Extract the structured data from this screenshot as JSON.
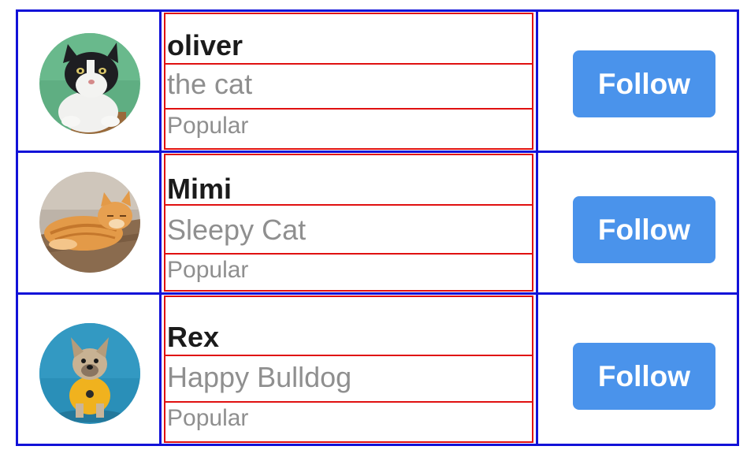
{
  "profiles": [
    {
      "name": "oliver",
      "subtitle": "the cat",
      "tag": "Popular",
      "follow_label": "Follow",
      "avatar_icon": "black-white-cat-photo"
    },
    {
      "name": "Mimi",
      "subtitle": "Sleepy Cat",
      "tag": "Popular",
      "follow_label": "Follow",
      "avatar_icon": "orange-tabby-cat-photo"
    },
    {
      "name": "Rex",
      "subtitle": "Happy Bulldog",
      "tag": "Popular",
      "follow_label": "Follow",
      "avatar_icon": "french-bulldog-photo"
    }
  ],
  "colors": {
    "row_border": "#1212d8",
    "info_border": "#e01010",
    "button_bg": "#4a93eb",
    "button_text": "#ffffff",
    "name_text": "#1b1b1b",
    "muted_text": "#8f8f8f"
  }
}
